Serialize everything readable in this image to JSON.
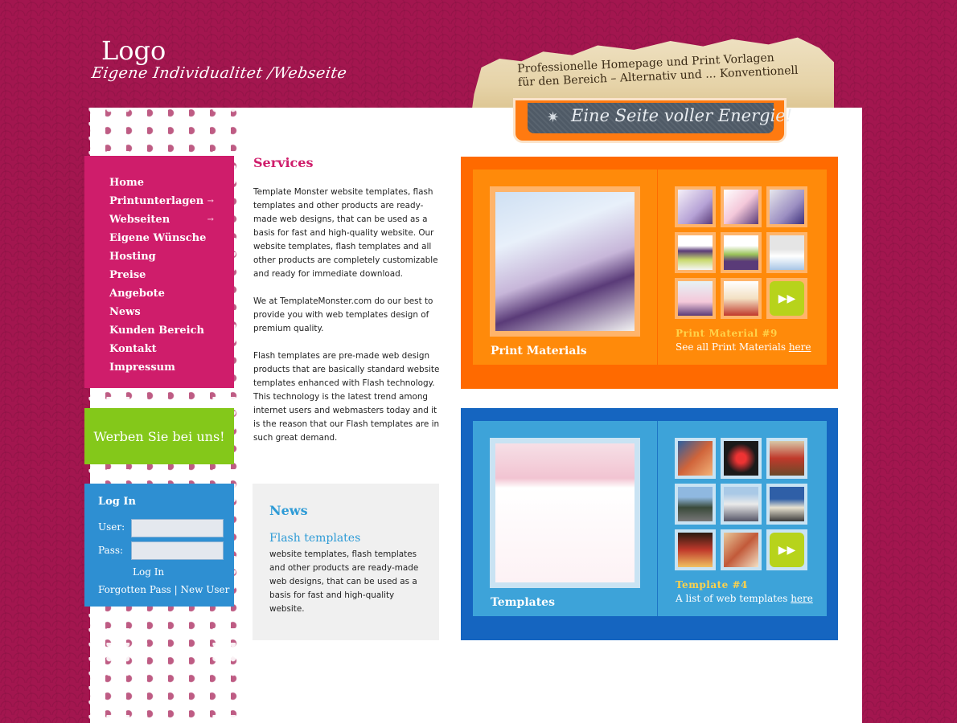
{
  "header": {
    "logo": "Logo",
    "tagline": "Eigene Individualitet /Webseite",
    "banner_line1": "Professionelle Homepage und Print Vorlagen",
    "banner_line2": "für den Bereich – Alternativ und ... Konventionell",
    "badge_text": "Eine Seite voller Energie!",
    "badge_icon": "gear-icon"
  },
  "nav": {
    "items": [
      {
        "label": "Home",
        "has_submenu": false
      },
      {
        "label": "Printunterlagen",
        "has_submenu": true
      },
      {
        "label": "Webseiten",
        "has_submenu": true
      },
      {
        "label": "Eigene Wünsche",
        "has_submenu": false
      },
      {
        "label": "Hosting",
        "has_submenu": false
      },
      {
        "label": "Preise",
        "has_submenu": false
      },
      {
        "label": "Angebote",
        "has_submenu": false
      },
      {
        "label": "News",
        "has_submenu": false
      },
      {
        "label": "Kunden Bereich",
        "has_submenu": false
      },
      {
        "label": "Kontakt",
        "has_submenu": false
      },
      {
        "label": "Impressum",
        "has_submenu": false
      }
    ],
    "submenu_icon": "arrow-right-icon"
  },
  "werben": "Werben Sie bei uns!",
  "login": {
    "title": "Log In",
    "user_label": "User:",
    "pass_label": "Pass:",
    "user_value": "",
    "pass_value": "",
    "button": "Log In",
    "forgot": "Forgotten Pass",
    "separator": "|",
    "new_user": "New User"
  },
  "services": {
    "title": "Services",
    "p1": "Template Monster website templates, flash templates and other products are ready-made web designs, that can be used as a basis for fast and high-quality website. Our website templates, flash templates and all other products are completely customizable and ready for immediate download.",
    "p2": "We at TemplateMonster.com do our best to provide you with web templates design of premium quality.",
    "p3": "Flash templates are pre-made web design products that are basically standard website templates enhanced with Flash technology. This technology is the latest trend among internet users and webmasters today and it is the reason that our Flash templates are in such great demand."
  },
  "news": {
    "title": "News",
    "subtitle": "Flash templates",
    "text": "website templates, flash templates and other products are ready-made web designs, that can be used as a basis for fast and high-quality website."
  },
  "print_box": {
    "feature_label": "Print Materials",
    "side_title": "Print Material #9",
    "link_prefix": "See all Print Materials",
    "link_text": "here",
    "next_icon": "fast-forward-icon",
    "colors": {
      "outer": "#ff6a00",
      "inner": "#ff8a0a"
    }
  },
  "templates_box": {
    "feature_label": "Templates",
    "side_title": "Template #4",
    "link_prefix": "A list of web templates",
    "link_text": "here",
    "next_icon": "fast-forward-icon",
    "colors": {
      "outer": "#1565c0",
      "inner": "#3da3d9"
    }
  }
}
